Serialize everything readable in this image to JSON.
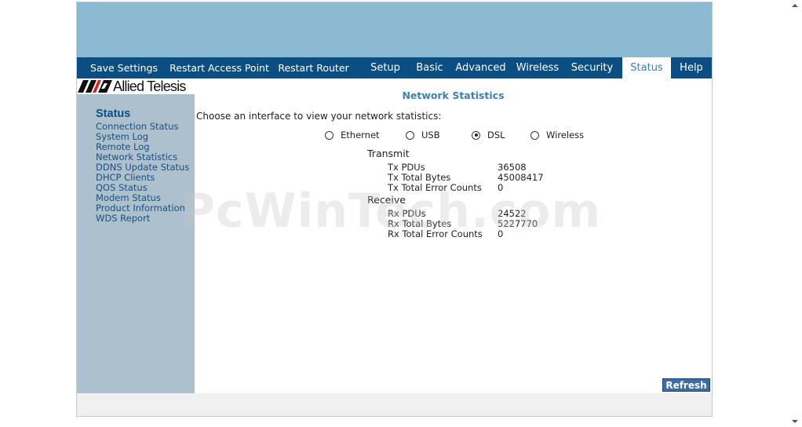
{
  "nav": {
    "items": [
      {
        "label": "Save Settings"
      },
      {
        "label": "Restart Access Point"
      },
      {
        "label": "Restart Router"
      },
      {
        "label": "Setup"
      },
      {
        "label": "Basic"
      },
      {
        "label": "Advanced"
      },
      {
        "label": "Wireless"
      },
      {
        "label": "Security"
      },
      {
        "label": "Status",
        "active": true
      },
      {
        "label": "Help"
      }
    ]
  },
  "logo": {
    "text": "Allied Telesis",
    "icon": "allied-telesis-logo"
  },
  "sidebar": {
    "title": "Status",
    "links": [
      "Connection Status",
      "System Log",
      "Remote Log",
      "Network Statistics",
      "DDNS Update Status",
      "DHCP Clients",
      "QOS Status",
      "Modem Status",
      "Product Information",
      "WDS Report"
    ]
  },
  "main": {
    "title": "Network Statistics",
    "intro": "Choose an interface to view your network statistics:",
    "interfaces": [
      {
        "label": "Ethernet",
        "checked": false
      },
      {
        "label": "USB",
        "checked": false
      },
      {
        "label": "DSL",
        "checked": true
      },
      {
        "label": "Wireless",
        "checked": false
      }
    ],
    "transmit": {
      "heading": "Transmit",
      "rows": [
        {
          "label": "Tx PDUs",
          "value": "36508"
        },
        {
          "label": "Tx Total Bytes",
          "value": "45008417"
        },
        {
          "label": "Tx Total Error Counts",
          "value": "0"
        }
      ]
    },
    "receive": {
      "heading": "Receive",
      "rows": [
        {
          "label": "Rx PDUs",
          "value": "24522"
        },
        {
          "label": "Rx Total Bytes",
          "value": "5227770"
        },
        {
          "label": "Rx Total Error Counts",
          "value": "0"
        }
      ]
    },
    "refresh_label": "Refresh"
  },
  "watermark": "PcWinTech.com",
  "colors": {
    "banner": "#8cbad3",
    "nav": "#0b4f82",
    "sidebar": "#acc0cd",
    "accent": "#3f7fb5",
    "button": "#3a6ea5"
  }
}
